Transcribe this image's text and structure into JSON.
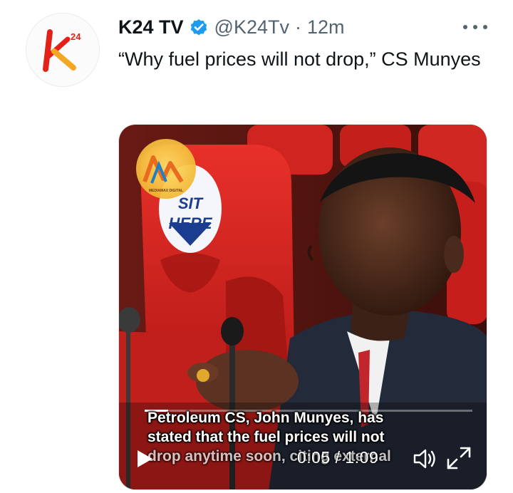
{
  "tweet": {
    "author": {
      "display_name": "K24 TV",
      "handle": "@K24Tv",
      "verified": true,
      "avatar_icon": "k24-logo-icon",
      "avatar_text": "24"
    },
    "separator": "·",
    "timestamp": "12m",
    "text": "“Why fuel prices will not drop,” CS Munyes",
    "more_icon": "more-dots-icon"
  },
  "video": {
    "watermark_text": "MEDIAMAX DIGITAL",
    "seat_sign_text": [
      "SIT",
      "HERE"
    ],
    "caption_lines": [
      "Petroleum CS, John Munyes, has",
      "stated that the fuel prices will not",
      "drop anytime soon, citing external"
    ],
    "current_time": "0:05",
    "duration": "1:09",
    "time_display": "0:05 / 1:09",
    "progress_fraction": 0.072,
    "play_icon": "play-icon",
    "volume_icon": "volume-icon",
    "fullscreen_icon": "fullscreen-icon"
  },
  "colors": {
    "text_primary": "#0f1419",
    "text_secondary": "#536471",
    "verified_blue": "#1d9bf0",
    "brand_red": "#e32119",
    "brand_yellow": "#f5a623",
    "seat_red": "#d9231f"
  }
}
